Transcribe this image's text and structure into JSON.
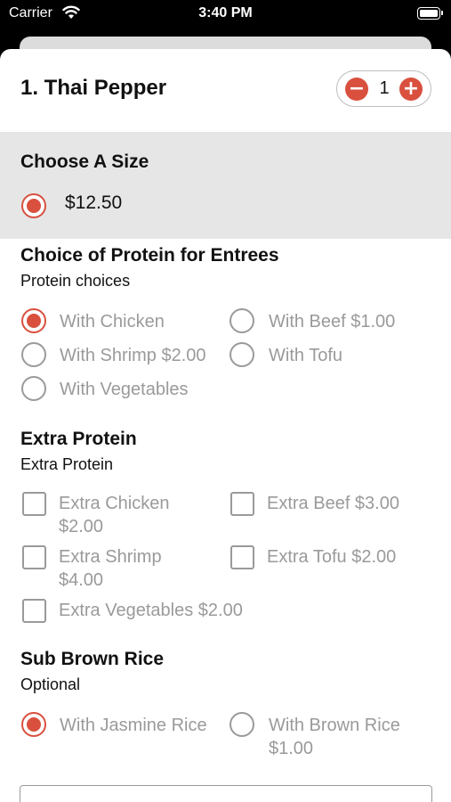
{
  "status_bar": {
    "carrier": "Carrier",
    "time": "3:40 PM"
  },
  "item": {
    "title": "1. Thai Pepper",
    "quantity": "1",
    "minus_symbol": "−",
    "plus_symbol": "+"
  },
  "size": {
    "title": "Choose A Size",
    "options": [
      {
        "label": "$12.50",
        "selected": true
      }
    ]
  },
  "protein": {
    "title": "Choice of Protein for Entrees",
    "subtitle": "Protein choices",
    "options": [
      {
        "label": "With Chicken",
        "selected": true
      },
      {
        "label": "With Beef $1.00",
        "selected": false
      },
      {
        "label": "With Shrimp $2.00",
        "selected": false
      },
      {
        "label": "With Tofu",
        "selected": false
      },
      {
        "label": "With Vegetables",
        "selected": false
      }
    ]
  },
  "extra_protein": {
    "title": "Extra Protein",
    "subtitle": "Extra Protein",
    "options": [
      {
        "label_line1": "Extra Chicken",
        "label_line2": "$2.00",
        "checked": false
      },
      {
        "label_line1": "Extra Beef $3.00",
        "label_line2": "",
        "checked": false
      },
      {
        "label_line1": "Extra Shrimp",
        "label_line2": "$4.00",
        "checked": false
      },
      {
        "label_line1": "Extra Tofu $2.00",
        "label_line2": "",
        "checked": false
      },
      {
        "label_line1": "Extra Vegetables $2.00",
        "label_line2": "",
        "checked": false
      }
    ]
  },
  "rice": {
    "title": "Sub Brown Rice",
    "subtitle": "Optional",
    "options": [
      {
        "label_line1": "With Jasmine Rice",
        "label_line2": "",
        "selected": true
      },
      {
        "label_line1": "With Brown Rice",
        "label_line2": "$1.00",
        "selected": false
      }
    ]
  },
  "colors": {
    "accent": "#d9503f",
    "disabled_text": "#9a9a9a",
    "section_bg": "#e6e6e6"
  },
  "icons": {
    "wifi": "wifi-icon",
    "battery": "battery-icon",
    "radio_selected": "radio-selected-icon",
    "radio_unselected": "radio-unselected-icon",
    "checkbox": "checkbox-icon"
  }
}
